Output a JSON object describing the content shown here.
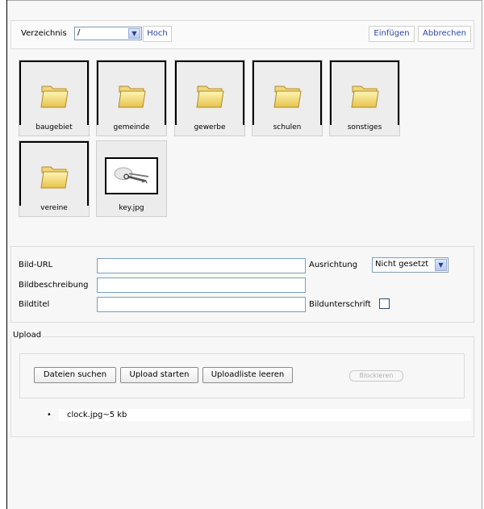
{
  "toolbar": {
    "dir_label": "Verzeichnis",
    "dir_value": "/",
    "up_label": "Hoch",
    "insert_label": "Einfügen",
    "cancel_label": "Abbrechen"
  },
  "tiles": [
    {
      "name": "baugebiet",
      "type": "folder"
    },
    {
      "name": "gemeinde",
      "type": "folder"
    },
    {
      "name": "gewerbe",
      "type": "folder"
    },
    {
      "name": "schulen",
      "type": "folder"
    },
    {
      "name": "sonstiges",
      "type": "folder"
    },
    {
      "name": "vereine",
      "type": "folder"
    },
    {
      "name": "key.jpg",
      "type": "image"
    }
  ],
  "props": {
    "url_label": "Bild-URL",
    "url_value": "",
    "desc_label": "Bildbeschreibung",
    "desc_value": "",
    "title_label": "Bildtitel",
    "title_value": "",
    "align_label": "Ausrichtung",
    "align_value": "Nicht gesetzt",
    "caption_label": "Bildunterschrift"
  },
  "upload": {
    "legend": "Upload",
    "browse_label": "Dateien suchen",
    "start_label": "Upload starten",
    "clear_label": "Uploadliste leeren",
    "block_label": "Blockieren",
    "files": [
      "clock.jpg~5 kb"
    ]
  },
  "icons": {
    "folder": "folder-icon",
    "dropdown": "chevron-down-icon",
    "image": "keys-thumbnail"
  }
}
